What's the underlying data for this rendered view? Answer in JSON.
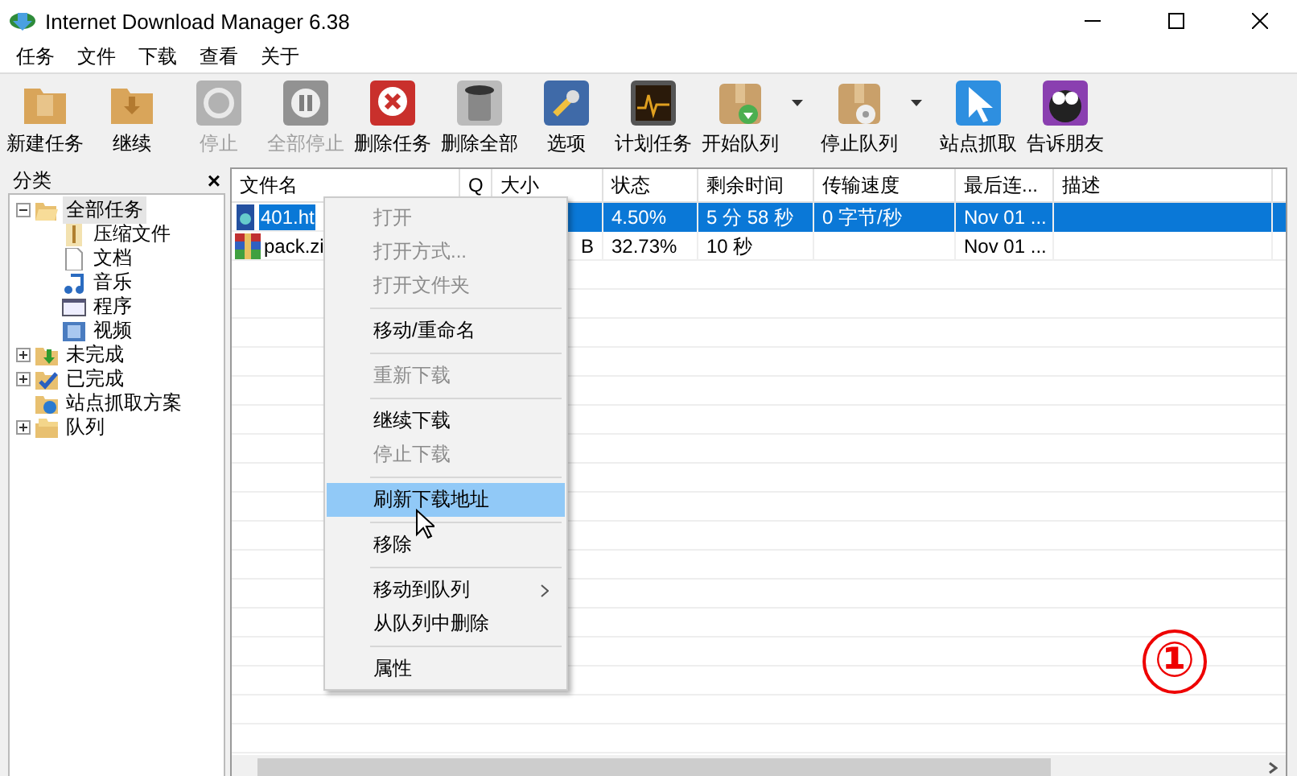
{
  "window": {
    "title": "Internet Download Manager 6.38"
  },
  "menu_bar": [
    "任务",
    "文件",
    "下载",
    "查看",
    "关于"
  ],
  "toolbar": [
    {
      "label": "新建任务",
      "kind": "folder-doc",
      "disabled": false,
      "dropdown": false
    },
    {
      "label": "继续",
      "kind": "folder-down",
      "disabled": false,
      "dropdown": false
    },
    {
      "label": "停止",
      "kind": "clock",
      "disabled": true,
      "dropdown": false
    },
    {
      "label": "全部停止",
      "kind": "pause",
      "disabled": true,
      "dropdown": false
    },
    {
      "label": "删除任务",
      "kind": "delete",
      "disabled": false,
      "dropdown": false
    },
    {
      "label": "删除全部",
      "kind": "trash",
      "disabled": false,
      "dropdown": false
    },
    {
      "label": "选项",
      "kind": "wrench",
      "disabled": false,
      "dropdown": false
    },
    {
      "label": "计划任务",
      "kind": "scope",
      "disabled": false,
      "dropdown": false
    },
    {
      "label": "开始队列",
      "kind": "box-go",
      "disabled": false,
      "dropdown": true
    },
    {
      "label": "停止队列",
      "kind": "box-stop",
      "disabled": false,
      "dropdown": true
    },
    {
      "label": "站点抓取",
      "kind": "pointer",
      "disabled": false,
      "dropdown": false
    },
    {
      "label": "告诉朋友",
      "kind": "face",
      "disabled": false,
      "dropdown": false
    }
  ],
  "sidebar": {
    "title": "分类",
    "close": "×",
    "tree": [
      {
        "label": "全部任务",
        "kind": "folder-open",
        "expanded": true,
        "selected": true,
        "children": [
          {
            "label": "压缩文件",
            "kind": "zip",
            "selected": false
          },
          {
            "label": "文档",
            "kind": "doc",
            "selected": false
          },
          {
            "label": "音乐",
            "kind": "music",
            "selected": false
          },
          {
            "label": "程序",
            "kind": "program",
            "selected": false
          },
          {
            "label": "视频",
            "kind": "video",
            "selected": false
          }
        ]
      },
      {
        "label": "未完成",
        "kind": "folder-down",
        "expanded": false,
        "selected": false
      },
      {
        "label": "已完成",
        "kind": "folder-check",
        "expanded": false,
        "selected": false
      },
      {
        "label": "站点抓取方案",
        "kind": "folder-ie",
        "selected": false
      },
      {
        "label": "队列",
        "kind": "folders",
        "expanded": false,
        "selected": false
      }
    ]
  },
  "table": {
    "columns": [
      "文件名",
      "Q",
      "大小",
      "状态",
      "剩余时间",
      "传输速度",
      "最后连...",
      "描述"
    ],
    "rows": [
      {
        "selected": true,
        "kind": "html",
        "cells": [
          "401.ht",
          null,
          null,
          "4.50%",
          "5 分 58 秒",
          "0 字节/秒",
          "Nov 01 ...",
          null
        ]
      },
      {
        "selected": false,
        "kind": "zip",
        "cells": [
          "pack.zi",
          null,
          "B",
          "32.73%",
          "10 秒",
          null,
          "Nov 01 ...",
          null
        ]
      }
    ]
  },
  "context_menu": [
    {
      "kind": "item",
      "label": "打开",
      "disabled": true,
      "selected": false
    },
    {
      "kind": "item",
      "label": "打开方式...",
      "disabled": true,
      "selected": false
    },
    {
      "kind": "item",
      "label": "打开文件夹",
      "disabled": true,
      "selected": false
    },
    {
      "kind": "separator"
    },
    {
      "kind": "item",
      "label": "移动/重命名",
      "disabled": false,
      "selected": false
    },
    {
      "kind": "separator"
    },
    {
      "kind": "item",
      "label": "重新下载",
      "disabled": true,
      "selected": false
    },
    {
      "kind": "separator"
    },
    {
      "kind": "item",
      "label": "继续下载",
      "disabled": false,
      "selected": false
    },
    {
      "kind": "item",
      "label": "停止下载",
      "disabled": true,
      "selected": false
    },
    {
      "kind": "separator"
    },
    {
      "kind": "item",
      "label": "刷新下载地址",
      "disabled": false,
      "selected": true
    },
    {
      "kind": "separator"
    },
    {
      "kind": "item",
      "label": "移除",
      "disabled": false,
      "selected": false
    },
    {
      "kind": "separator"
    },
    {
      "kind": "item",
      "label": "移动到队列",
      "disabled": false,
      "selected": false,
      "submenu": true
    },
    {
      "kind": "item",
      "label": "从队列中删除",
      "disabled": false,
      "selected": false
    },
    {
      "kind": "separator"
    },
    {
      "kind": "item",
      "label": "属性",
      "disabled": false,
      "selected": false
    }
  ],
  "annotation": "①"
}
